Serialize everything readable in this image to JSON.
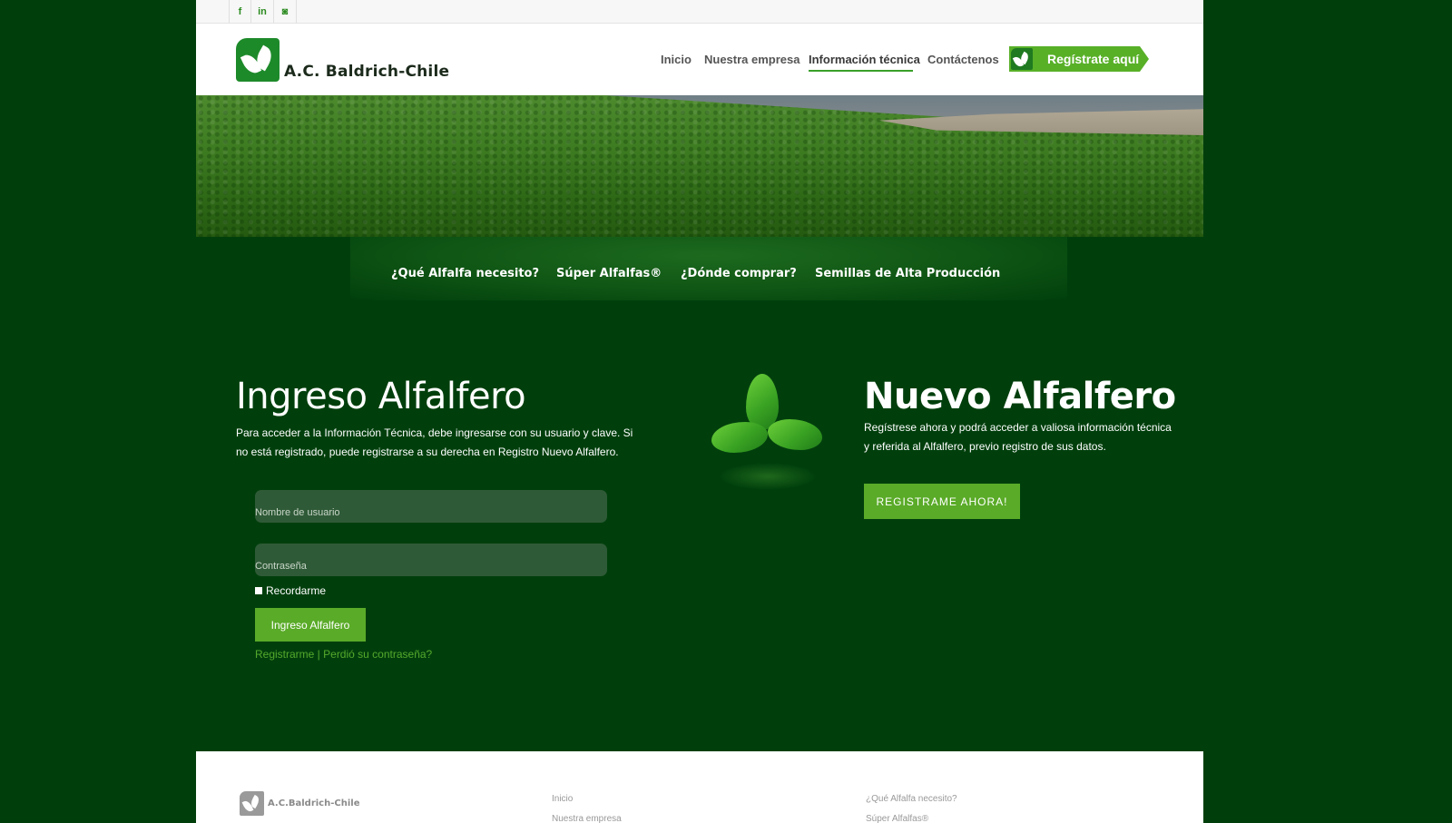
{
  "topbar": {
    "social": [
      {
        "name": "facebook",
        "glyph": "f"
      },
      {
        "name": "linkedin",
        "glyph": "in"
      },
      {
        "name": "instagram",
        "glyph": "◙"
      }
    ]
  },
  "header": {
    "logo_text": "A.C. Baldrich-Chile",
    "nav": [
      "Inicio",
      "Nuestra empresa",
      "Información técnica",
      "Contáctenos"
    ],
    "active_nav": "Información técnica",
    "register_button": "Regístrate aquí"
  },
  "subnav": [
    "¿Qué Alfalfa necesito?",
    "Súper Alfalfas®",
    "¿Dónde comprar?",
    "Semillas de Alta Producción"
  ],
  "login": {
    "title": "Ingreso Alfalfero",
    "description": "Para acceder a la Información Técnica, debe ingresarse con su usuario y clave. Si no está registrado, puede registrarse a su derecha en Registro Nuevo Alfalfero.",
    "username_placeholder": "Nombre de usuario",
    "password_placeholder": "Contraseña",
    "remember_label": "Recordarme",
    "submit_label": "Ingreso Alfalfero",
    "links": "Registrarme | Perdió su contraseña?"
  },
  "register": {
    "title": "Nuevo Alfalfero",
    "description": "Regístrese ahora y podrá acceder a valiosa información técnica y referida al Alfalfero, previo registro de sus datos.",
    "button_label": "REGISTRAME AHORA!"
  },
  "footer": {
    "logo_text": "A.C.Baldrich-Chile",
    "col1": [
      "Inicio",
      "Nuestra empresa"
    ],
    "col2": [
      "¿Qué Alfalfa necesito?",
      "Súper Alfalfas®"
    ]
  },
  "colors": {
    "background": "#003f0c",
    "accent": "#5aab28",
    "brand": "#1d8a2a"
  }
}
